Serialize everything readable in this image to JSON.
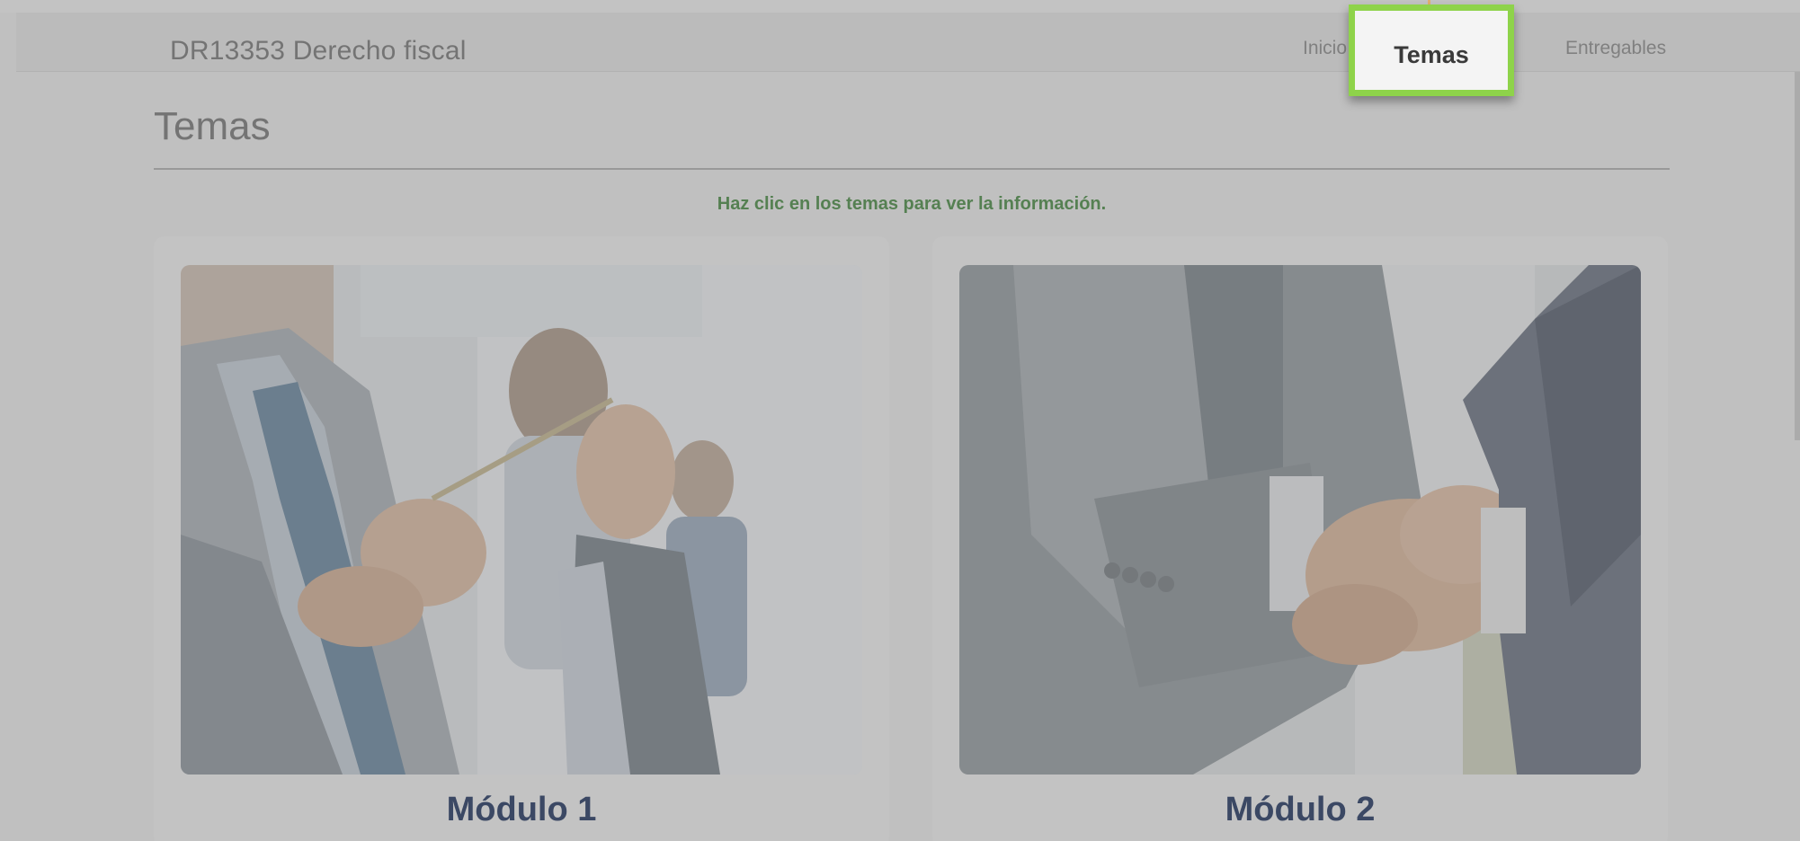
{
  "navbar": {
    "brand": "DR13353 Derecho fiscal",
    "links": [
      {
        "label": "Inicio"
      },
      {
        "label": "Temas"
      },
      {
        "label": "Entregables"
      }
    ]
  },
  "main": {
    "title": "Temas",
    "hint": "Haz clic en los temas para ver la información.",
    "cards": [
      {
        "title": "Módulo 1",
        "image": "business-meeting-pen-photo"
      },
      {
        "title": "Módulo 2",
        "image": "handshake-photo"
      }
    ]
  },
  "tour": {
    "highlight_label": "Temas",
    "accent_color": "#8ed34a"
  },
  "colors": {
    "hint": "#5f9a5a",
    "card_title": "#3b4d73"
  }
}
